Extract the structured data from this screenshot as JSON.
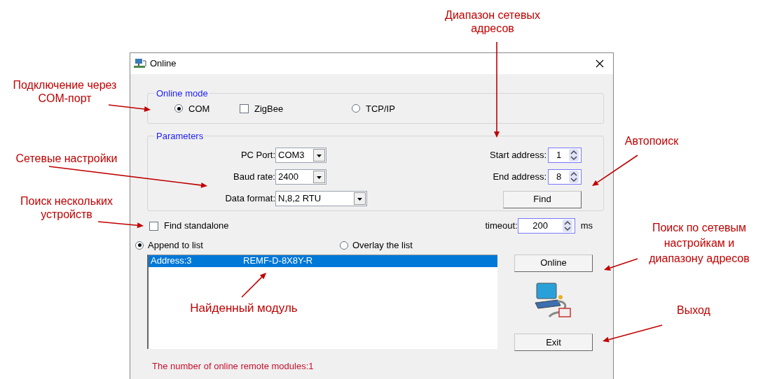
{
  "annotations": [
    {
      "text": "Подключение через COM-порт"
    },
    {
      "text": "Сетевые настройки"
    },
    {
      "text": "Поиск нескольких устройств"
    },
    {
      "text": "Диапазон сетевых адресов"
    },
    {
      "text": "Автопоиск"
    },
    {
      "text": "Поиск по сетевым настройкам и диапазону адресов"
    },
    {
      "text": "Выход"
    },
    {
      "text": "Найденный модуль"
    }
  ],
  "window": {
    "title": "Online"
  },
  "online_mode": {
    "legend": "Online mode",
    "options": [
      {
        "kind": "radio",
        "label": "COM",
        "selected": true
      },
      {
        "kind": "checkbox",
        "label": "ZigBee",
        "checked": false
      },
      {
        "kind": "radio",
        "label": "TCP/IP",
        "selected": false
      }
    ]
  },
  "parameters": {
    "legend": "Parameters",
    "pc_port": {
      "label": "PC Port:",
      "value": "COM3"
    },
    "baud_rate": {
      "label": "Baud rate:",
      "value": "2400"
    },
    "data_format": {
      "label": "Data format:",
      "value": "N,8,2 RTU"
    },
    "start_address": {
      "label": "Start address:",
      "value": "1"
    },
    "end_address": {
      "label": "End address:",
      "value": "8"
    },
    "find_button": "Find"
  },
  "find_standalone": {
    "label": "Find standalone",
    "checked": false
  },
  "timeout": {
    "label": "timeout:",
    "value": "200",
    "unit": "ms"
  },
  "list_mode": [
    {
      "label": "Append to list",
      "selected": true
    },
    {
      "label": "Overlay the list",
      "selected": false
    }
  ],
  "modules": [
    {
      "address": "Address:3",
      "model": "REMF-D-8X8Y-R",
      "selected": true
    }
  ],
  "online_button": "Online",
  "exit_button": "Exit",
  "status": "The number of online remote modules:1"
}
